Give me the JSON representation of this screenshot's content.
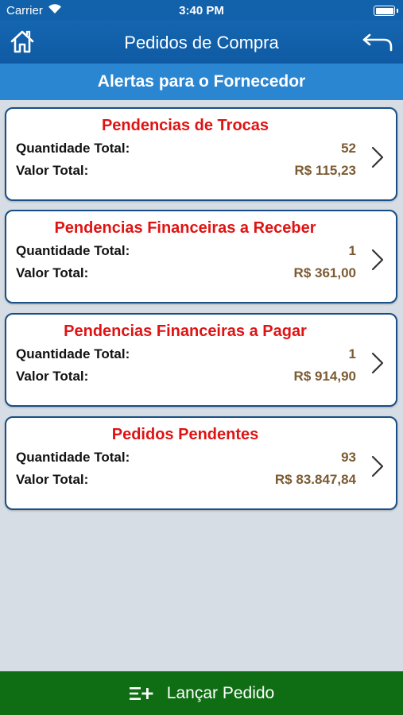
{
  "status_bar": {
    "carrier": "Carrier",
    "time": "3:40 PM"
  },
  "nav": {
    "title": "Pedidos de Compra",
    "home_icon": "home-icon",
    "back_icon": "back-arrow-icon"
  },
  "section_header": "Alertas para o Fornecedor",
  "cards": [
    {
      "title": "Pendencias de Trocas",
      "qty_label": "Quantidade Total:",
      "qty": "52",
      "value_label": "Valor Total:",
      "value": "R$ 115,23"
    },
    {
      "title": "Pendencias Financeiras a Receber",
      "qty_label": "Quantidade Total:",
      "qty": "1",
      "value_label": "Valor Total:",
      "value": "R$ 361,00"
    },
    {
      "title": "Pendencias Financeiras a Pagar",
      "qty_label": "Quantidade Total:",
      "qty": "1",
      "value_label": "Valor Total:",
      "value": "R$ 914,90"
    },
    {
      "title": "Pedidos Pendentes",
      "qty_label": "Quantidade Total:",
      "qty": "93",
      "value_label": "Valor Total:",
      "value": "R$ 83.847,84"
    }
  ],
  "footer": {
    "label": "Lançar Pedido",
    "icon": "list-add-icon"
  },
  "colors": {
    "nav_blue": "#1262ab",
    "header_blue": "#2b86d2",
    "card_title_red": "#e01313",
    "value_brown": "#7b5b33",
    "footer_green": "#0f6d14",
    "background": "#d6dde4"
  }
}
